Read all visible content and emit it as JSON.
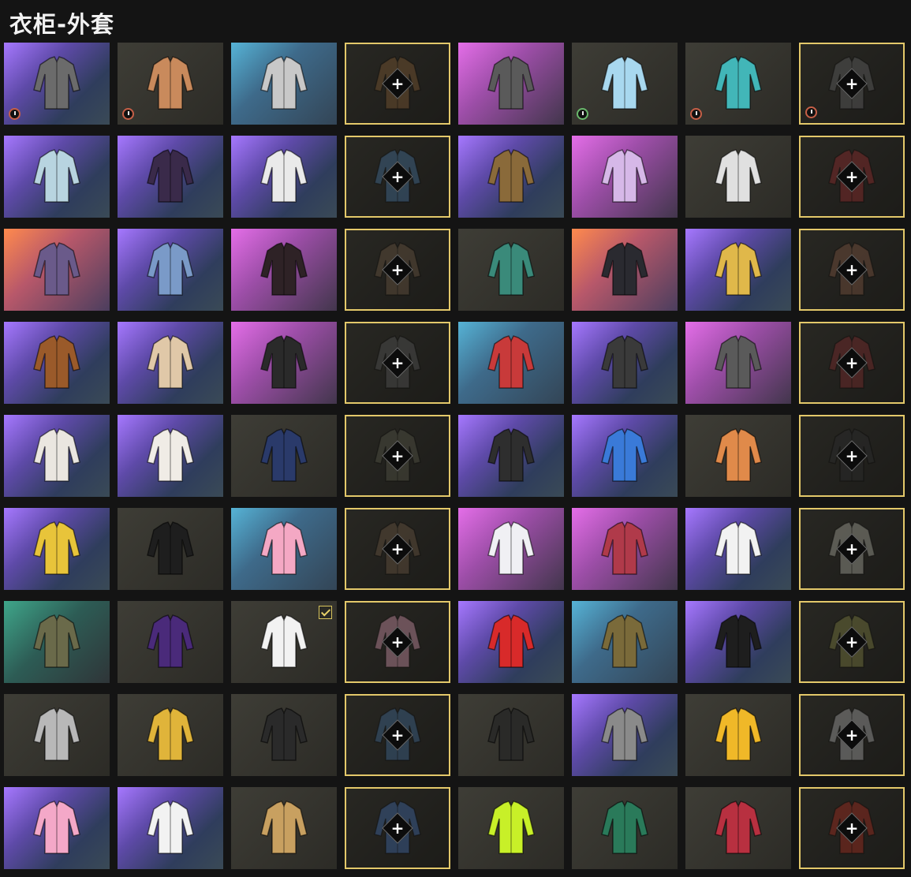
{
  "header": {
    "title": "衣柜-外套"
  },
  "colors": {
    "accent": "#e3c86a",
    "background": "#141414"
  },
  "slots": [
    {
      "bg": "purple",
      "color": "#6b6b6b",
      "empty": false,
      "timer": "red"
    },
    {
      "bg": "dark",
      "color": "#c98a5c",
      "empty": false,
      "timer": "red"
    },
    {
      "bg": "blue",
      "color": "#c8c8c8",
      "empty": false
    },
    {
      "bg": "dark",
      "color": "#6b4e2f",
      "empty": true
    },
    {
      "bg": "pink",
      "color": "#5a5a5a",
      "empty": false
    },
    {
      "bg": "dark",
      "color": "#a8d8ef",
      "empty": false,
      "timer": "green"
    },
    {
      "bg": "dark",
      "color": "#42b6b8",
      "empty": false,
      "timer": "red"
    },
    {
      "bg": "dark",
      "color": "#555555",
      "empty": true,
      "timer": "red"
    },
    {
      "bg": "purple",
      "color": "#b8d4e0",
      "empty": false
    },
    {
      "bg": "purple",
      "color": "#3a2a4a",
      "empty": false
    },
    {
      "bg": "purple",
      "color": "#eaeaea",
      "empty": false
    },
    {
      "bg": "dark",
      "color": "#3e6080",
      "empty": true
    },
    {
      "bg": "purple",
      "color": "#8a6a3a",
      "empty": false
    },
    {
      "bg": "pink",
      "color": "#d6b8e8",
      "empty": false
    },
    {
      "bg": "dark",
      "color": "#e0e0e0",
      "empty": false
    },
    {
      "bg": "dark",
      "color": "#7a2a2a",
      "empty": true
    },
    {
      "bg": "orange",
      "color": "#6a5a8a",
      "empty": false
    },
    {
      "bg": "purple",
      "color": "#7a9ac8",
      "empty": false
    },
    {
      "bg": "pink",
      "color": "#2e2226",
      "empty": false
    },
    {
      "bg": "dark",
      "color": "#5a4a3a",
      "empty": true
    },
    {
      "bg": "dark",
      "color": "#3a8a7a",
      "empty": false
    },
    {
      "bg": "orange",
      "color": "#2a2a30",
      "empty": false
    },
    {
      "bg": "purple",
      "color": "#e0b84a",
      "empty": false
    },
    {
      "bg": "dark",
      "color": "#6a4a3a",
      "empty": true
    },
    {
      "bg": "purple",
      "color": "#9a5a2a",
      "empty": false
    },
    {
      "bg": "purple",
      "color": "#e0c8a8",
      "empty": false
    },
    {
      "bg": "pink",
      "color": "#2a2a2a",
      "empty": false
    },
    {
      "bg": "dark",
      "color": "#4a4a4a",
      "empty": true
    },
    {
      "bg": "blue",
      "color": "#c83a3a",
      "empty": false
    },
    {
      "bg": "purple",
      "color": "#3a3a3a",
      "empty": false
    },
    {
      "bg": "pink",
      "color": "#5a5a5a",
      "empty": false
    },
    {
      "bg": "dark",
      "color": "#6a2a2a",
      "empty": true
    },
    {
      "bg": "purple",
      "color": "#eae6e0",
      "empty": false
    },
    {
      "bg": "purple",
      "color": "#f0ece6",
      "empty": false
    },
    {
      "bg": "dark",
      "color": "#2a3a6a",
      "empty": false
    },
    {
      "bg": "dark",
      "color": "#4a4a3e",
      "empty": true
    },
    {
      "bg": "purple",
      "color": "#2e2e2e",
      "empty": false
    },
    {
      "bg": "purple",
      "color": "#3a7ad8",
      "empty": false
    },
    {
      "bg": "dark",
      "color": "#e08a4a",
      "empty": false
    },
    {
      "bg": "dark",
      "color": "#2a2a2a",
      "empty": true
    },
    {
      "bg": "purple",
      "color": "#e8c43a",
      "empty": false
    },
    {
      "bg": "dark",
      "color": "#1e1e1e",
      "empty": false
    },
    {
      "bg": "blue",
      "color": "#f4a8c4",
      "empty": false
    },
    {
      "bg": "dark",
      "color": "#5a4a3a",
      "empty": true
    },
    {
      "bg": "pink",
      "color": "#f0f0f4",
      "empty": false
    },
    {
      "bg": "pink",
      "color": "#b03a4a",
      "empty": false
    },
    {
      "bg": "purple",
      "color": "#f2f2f2",
      "empty": false
    },
    {
      "bg": "dark",
      "color": "#8a8a80",
      "empty": true
    },
    {
      "bg": "green",
      "color": "#6a6a4a",
      "empty": false
    },
    {
      "bg": "dark",
      "color": "#4a2a7a",
      "empty": false
    },
    {
      "bg": "dark",
      "color": "#f2f2f2",
      "empty": false,
      "check": true
    },
    {
      "bg": "dark",
      "color": "#a87a8a",
      "empty": true
    },
    {
      "bg": "purple",
      "color": "#d82a2a",
      "empty": false
    },
    {
      "bg": "blue",
      "color": "#7a6a3a",
      "empty": false
    },
    {
      "bg": "purple",
      "color": "#1e1e1e",
      "empty": false
    },
    {
      "bg": "dark",
      "color": "#6a6a3a",
      "empty": true
    },
    {
      "bg": "dark",
      "color": "#b8b8b8",
      "empty": false
    },
    {
      "bg": "dark",
      "color": "#e0b43a",
      "empty": false
    },
    {
      "bg": "dark",
      "color": "#2a2a2a",
      "empty": false
    },
    {
      "bg": "dark",
      "color": "#3a5a7a",
      "empty": true
    },
    {
      "bg": "dark",
      "color": "#2a2a28",
      "empty": false
    },
    {
      "bg": "purple",
      "color": "#8a8a8a",
      "empty": false
    },
    {
      "bg": "dark",
      "color": "#f0b828",
      "empty": false
    },
    {
      "bg": "dark",
      "color": "#8a8a8a",
      "empty": true
    },
    {
      "bg": "purple",
      "color": "#f4a8c8",
      "empty": false
    },
    {
      "bg": "purple",
      "color": "#f2f2f2",
      "empty": false
    },
    {
      "bg": "dark",
      "color": "#c8a060",
      "empty": false
    },
    {
      "bg": "dark",
      "color": "#3a5a8a",
      "empty": true
    },
    {
      "bg": "dark",
      "color": "#c8f028",
      "empty": false
    },
    {
      "bg": "dark",
      "color": "#2a7a5a",
      "empty": false
    },
    {
      "bg": "dark",
      "color": "#b83040",
      "empty": false
    },
    {
      "bg": "dark",
      "color": "#8a2a1e",
      "empty": true
    }
  ]
}
